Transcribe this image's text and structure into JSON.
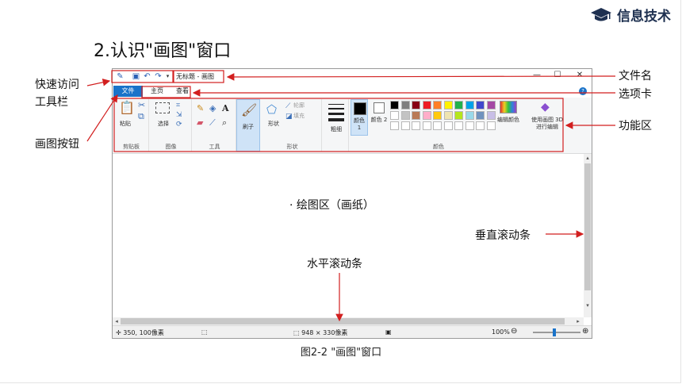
{
  "brand": {
    "label": "信息技术",
    "icon": "graduation-cap-icon"
  },
  "heading": "2.认识\"画图\"窗口",
  "caption": "图2-2 \"画图\"窗口",
  "callouts": {
    "quick_access": "快速访问工具栏",
    "quick_access_line1": "快速访问",
    "quick_access_line2": "工具栏",
    "paint_button": "画图按钮",
    "file_name": "文件名",
    "tabs": "选项卡",
    "function_area": "功能区",
    "vertical_scrollbar": "垂直滚动条",
    "horizontal_scrollbar": "水平滚动条",
    "drawing_area": "· 绘图区（画纸）"
  },
  "window": {
    "title": "无标题 - 画图",
    "controls": {
      "minimize": "—",
      "maximize": "☐",
      "close": "✕"
    },
    "menu": {
      "file": "文件",
      "home": "主页",
      "view": "查看"
    },
    "ribbon": {
      "clipboard": {
        "label": "剪贴板",
        "paste": "粘贴"
      },
      "image": {
        "label": "图像",
        "select": "选择"
      },
      "tools": {
        "label": "工具"
      },
      "brushes": {
        "label": "刷子"
      },
      "shapes": {
        "label": "形状",
        "shapes_btn": "形状",
        "outline": "轮廓",
        "fill": "填充"
      },
      "size": {
        "label": "粗细"
      },
      "colors": {
        "label": "颜色",
        "color1": "颜色 1",
        "color2": "颜色 2",
        "edit_colors": "编辑颜色",
        "paint3d": "使用画图 3D 进行编辑",
        "palette_row1": [
          "#000000",
          "#7f7f7f",
          "#880015",
          "#ed1c24",
          "#ff7f27",
          "#fff200",
          "#22b14c",
          "#00a2e8",
          "#3f48cc",
          "#a349a4"
        ],
        "palette_row2": [
          "#ffffff",
          "#c3c3c3",
          "#b97a57",
          "#ffaec9",
          "#ffc90e",
          "#efe4b0",
          "#b5e61d",
          "#99d9ea",
          "#7092be",
          "#c8bfe7"
        ]
      }
    },
    "status": {
      "cursor": "350, 100像素",
      "canvas_size": "948 × 330像素",
      "zoom": "100%"
    }
  }
}
